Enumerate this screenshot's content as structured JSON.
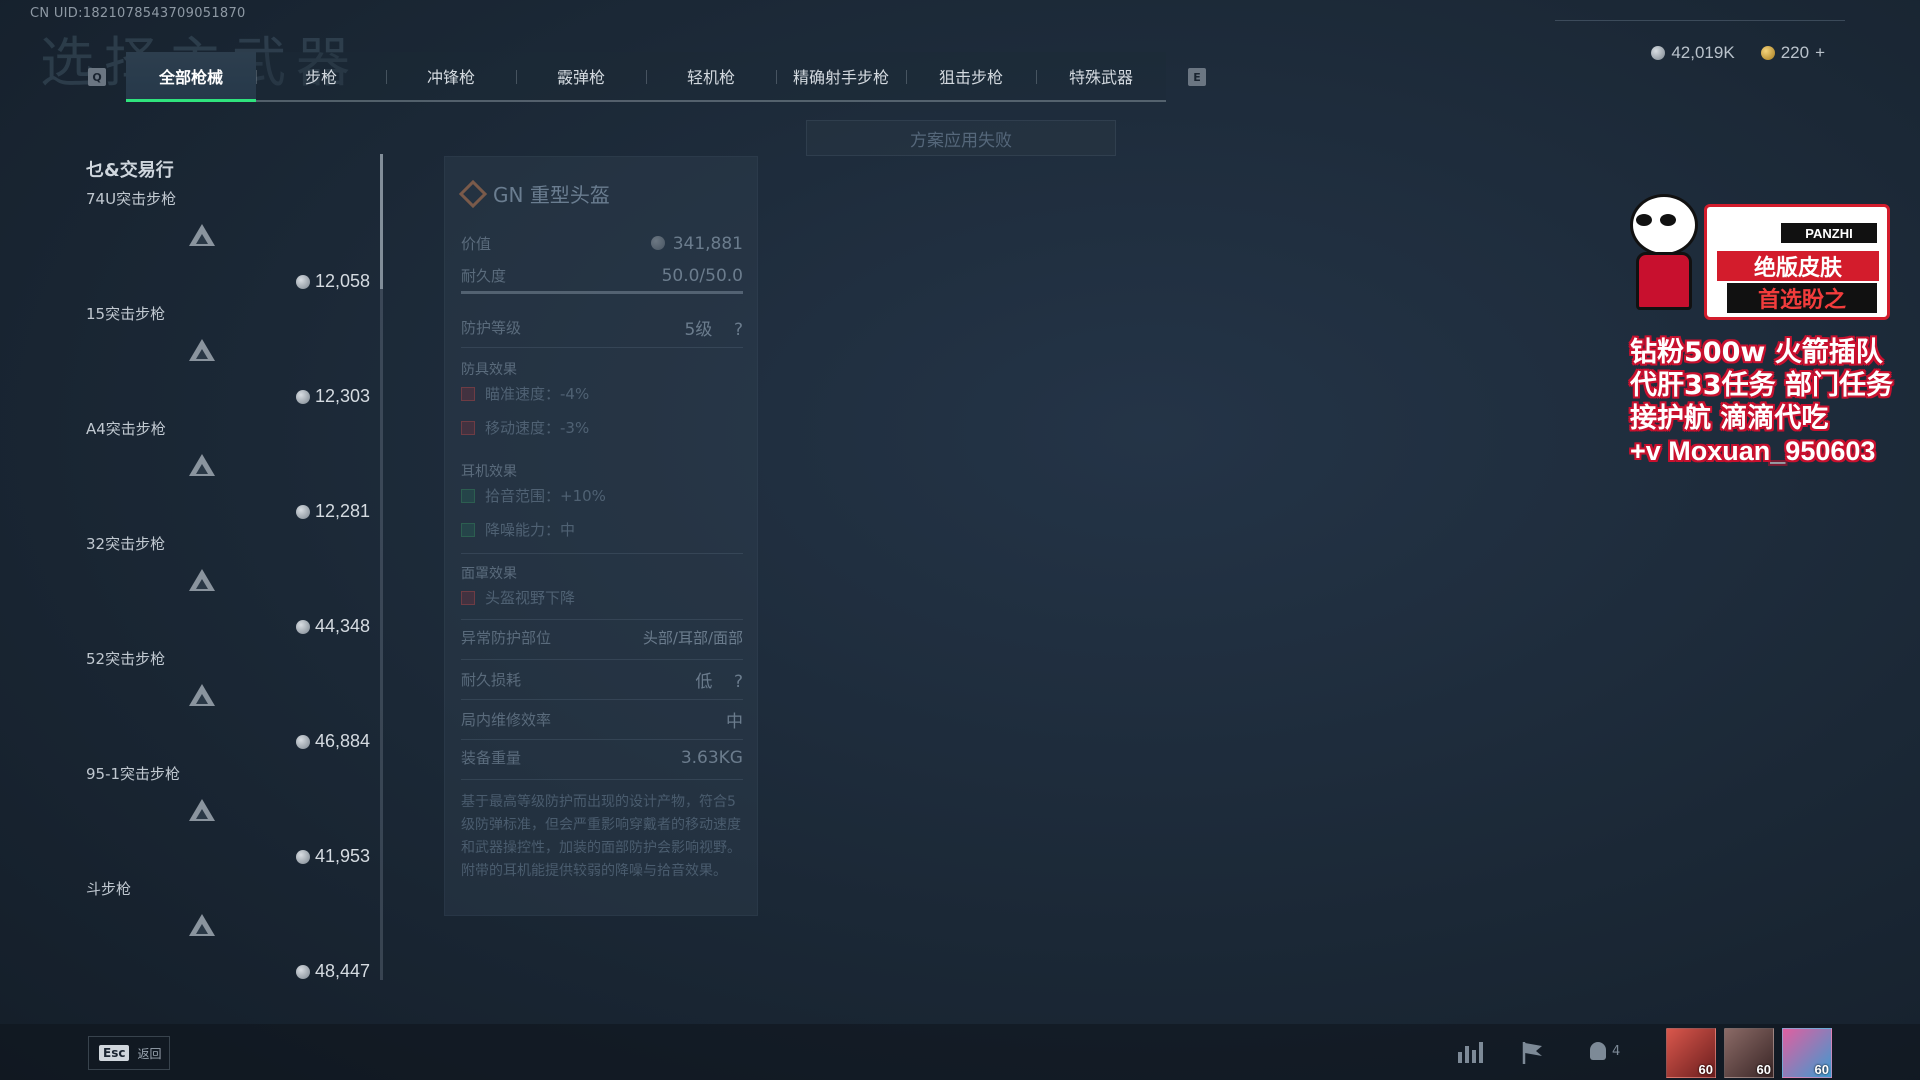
{
  "uid_text": "CN UID:1821078543709051870",
  "bg_title": "选择主武器",
  "currency": {
    "silver": "42,019K",
    "gold": "220",
    "add_icon": "+"
  },
  "tabs": {
    "left_key": "Q",
    "right_key": "E",
    "items": [
      {
        "label": "全部枪械",
        "active": true
      },
      {
        "label": "步枪"
      },
      {
        "label": "冲锋枪"
      },
      {
        "label": "霰弹枪"
      },
      {
        "label": "轻机枪"
      },
      {
        "label": "精确射手步枪"
      },
      {
        "label": "狙击步枪"
      },
      {
        "label": "特殊武器"
      }
    ]
  },
  "apply_status": "方案应用失败",
  "list": {
    "header": "乜&交易行",
    "items": [
      {
        "name": "74U突击步枪",
        "price": "12,058"
      },
      {
        "name": "15突击步枪",
        "price": "12,303"
      },
      {
        "name": "A4突击步枪",
        "price": "12,281"
      },
      {
        "name": "32突击步枪",
        "price": "44,348"
      },
      {
        "name": "52突击步枪",
        "price": "46,884"
      },
      {
        "name": "95-1突击步枪",
        "price": "41,953"
      },
      {
        "name": "斗步枪",
        "price": "48,447"
      }
    ]
  },
  "card": {
    "title": "GN 重型头盔",
    "value_label": "价值",
    "value": "341,881",
    "durability_label": "耐久度",
    "durability": "50.0/50.0",
    "protection_label": "防护等级",
    "protection": "5级",
    "help": "?",
    "armor_section": "防具效果",
    "armor_effects": [
      "瞄准速度：-4%",
      "移动速度：-3%"
    ],
    "ear_section": "耳机效果",
    "ear_effects": [
      "拾音范围：+10%",
      "降噪能力：中"
    ],
    "face_section": "面罩效果",
    "face_effects": [
      "头盔视野下降"
    ],
    "zones_label": "异常防护部位",
    "zones": "头部/耳部/面部",
    "wear_label": "耐久损耗",
    "wear": "低",
    "repair_label": "局内维修效率",
    "repair": "中",
    "weight_label": "装备重量",
    "weight": "3.63KG",
    "description": "基于最高等级防护而出现的设计产物，符合5级防弹标准，但会严重影响穿戴者的移动速度和武器操控性，加装的面部防护会影响视野。附带的耳机能提供较弱的降噪与拾音效果。"
  },
  "ad": {
    "brand": "PANZHI",
    "badge1": "绝版皮肤",
    "badge2": "首选盼之",
    "lines": [
      "钻粉500w 火箭插队",
      "代肝33任务 部门任务",
      "接护航 滴滴代吃",
      "+v Moxuan_950603"
    ]
  },
  "bottom": {
    "esc_key": "Esc",
    "back_label": "返回",
    "team_count": "4",
    "avatars": [
      {
        "level": "60",
        "color": "#b8413a"
      },
      {
        "level": "60",
        "color": "#6b4b4b"
      },
      {
        "level": "60",
        "color": "#4aa3c8"
      }
    ]
  }
}
